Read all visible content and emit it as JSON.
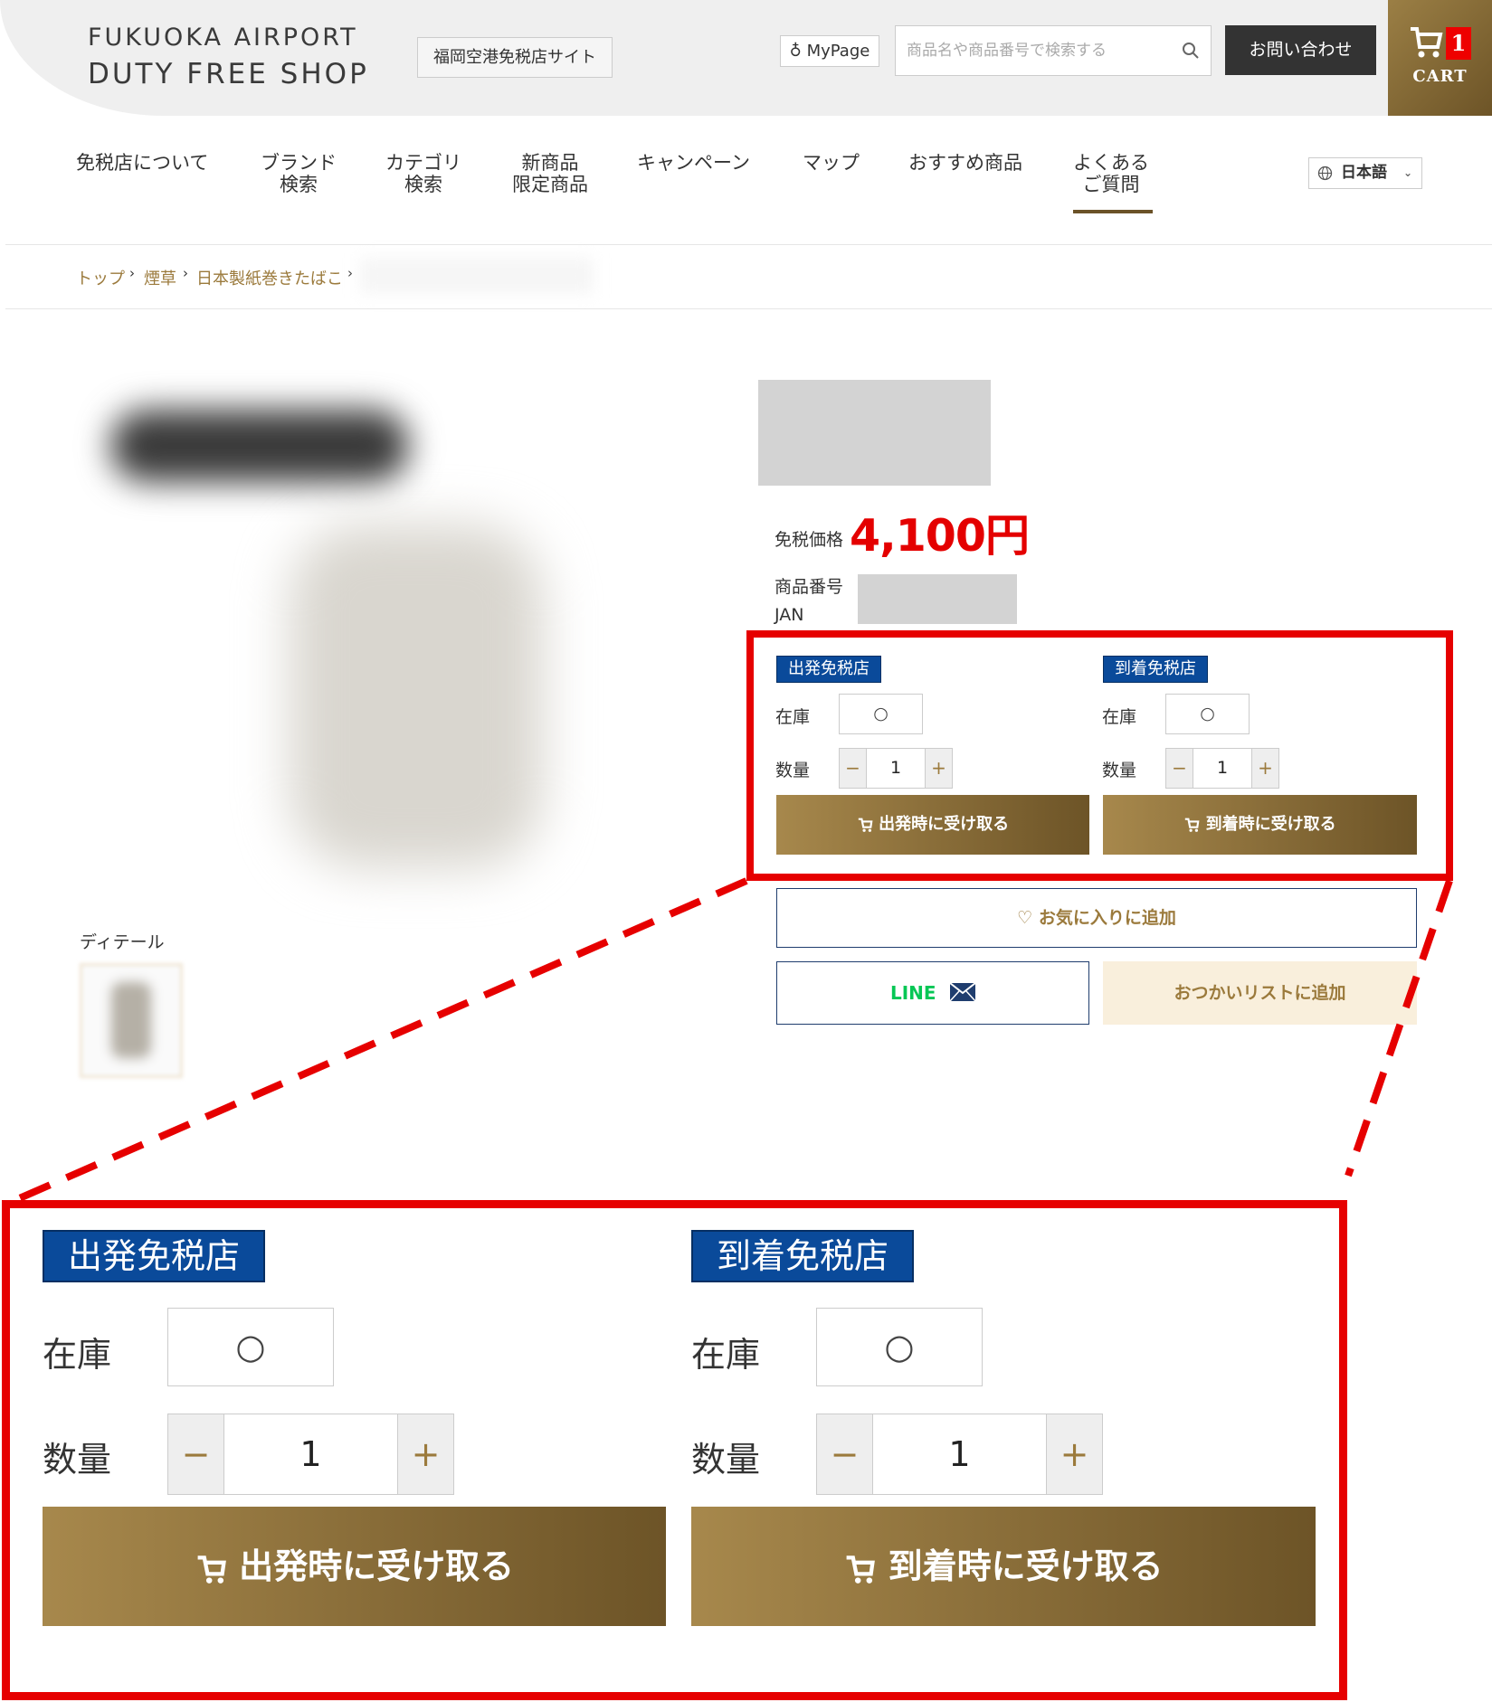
{
  "header": {
    "logo_line1": "FUKUOKA AIRPORT",
    "logo_line2": "DUTY FREE SHOP",
    "site_label": "福岡空港免税店サイト",
    "mypage_label": "MyPage",
    "search_placeholder": "商品名や商品番号で検索する",
    "contact_label": "お問い合わせ",
    "cart_label": "CART",
    "cart_count": "1"
  },
  "nav": {
    "items": [
      "免税店について",
      "ブランド\n検索",
      "カテゴリ\n検索",
      "新商品\n限定商品",
      "キャンペーン",
      "マップ",
      "おすすめ商品",
      "よくある\nご質問"
    ],
    "language": "日本語"
  },
  "breadcrumb": [
    "トップ",
    "煙草",
    "日本製紙巻きたばこ"
  ],
  "product": {
    "detail_label": "ディテール",
    "price_label": "免税価格",
    "price_value": "4,100円",
    "code_label": "商品番号",
    "jan_label": "JAN"
  },
  "stores": [
    {
      "tag": "出発免税店",
      "stock_label": "在庫",
      "stock_value": "○",
      "qty_label": "数量",
      "qty_value": "1",
      "button_label": "出発時に受け取る"
    },
    {
      "tag": "到着免税店",
      "stock_label": "在庫",
      "stock_value": "○",
      "qty_label": "数量",
      "qty_value": "1",
      "button_label": "到着時に受け取る"
    }
  ],
  "actions": {
    "favorite_label": "お気に入りに追加",
    "line_label": "LINE",
    "list_label": "おつかいリストに追加"
  },
  "colors": {
    "accent_gold": "#9b7a3c",
    "store_tag_blue": "#0a4a9a",
    "price_red": "#e40000",
    "highlight_red": "#e60000"
  }
}
